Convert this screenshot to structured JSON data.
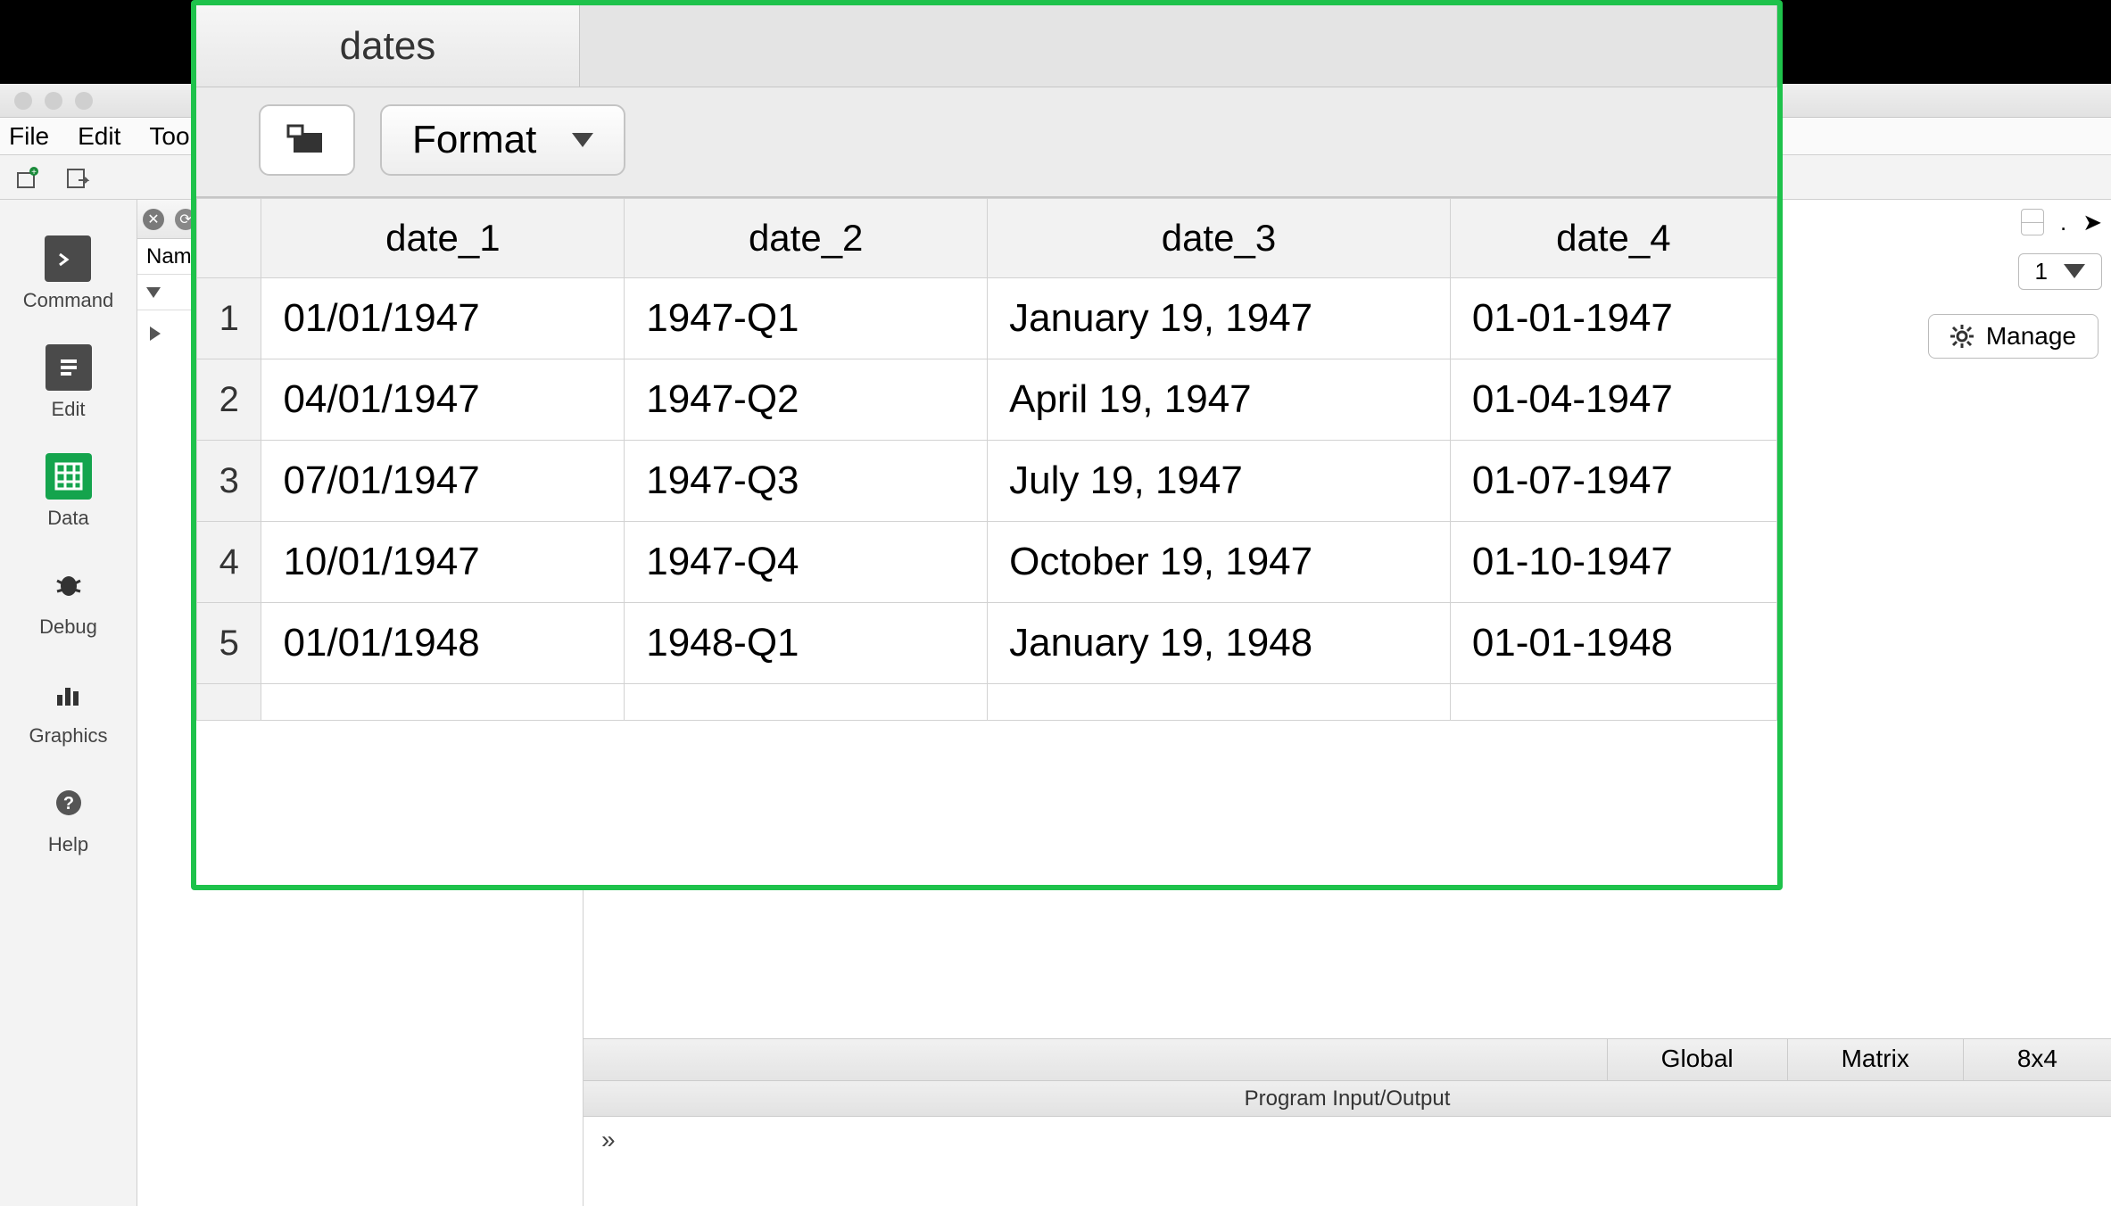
{
  "menubar": {
    "file": "File",
    "edit": "Edit",
    "tool": "Tool"
  },
  "sidebar": {
    "command": "Command",
    "edit": "Edit",
    "data": "Data",
    "debug": "Debug",
    "graphics": "Graphics",
    "help": "Help"
  },
  "names_pane": {
    "header": "Nam"
  },
  "right": {
    "select_value": "1",
    "manage": "Manage"
  },
  "status": {
    "global": "Global",
    "matrix": "Matrix",
    "dims": "8x4"
  },
  "io": {
    "title": "Program Input/Output",
    "prompt": "»"
  },
  "viewer": {
    "tab": "dates",
    "format_label": "Format",
    "columns": [
      "date_1",
      "date_2",
      "date_3",
      "date_4"
    ],
    "rows": [
      {
        "n": "1",
        "c": [
          "01/01/1947",
          "1947-Q1",
          "January 19, 1947",
          "01-01-1947"
        ]
      },
      {
        "n": "2",
        "c": [
          "04/01/1947",
          "1947-Q2",
          "April 19, 1947",
          "01-04-1947"
        ]
      },
      {
        "n": "3",
        "c": [
          "07/01/1947",
          "1947-Q3",
          "July 19, 1947",
          "01-07-1947"
        ]
      },
      {
        "n": "4",
        "c": [
          "10/01/1947",
          "1947-Q4",
          "October 19, 1947",
          "01-10-1947"
        ]
      },
      {
        "n": "5",
        "c": [
          "01/01/1948",
          "1948-Q1",
          "January 19, 1948",
          "01-01-1948"
        ]
      }
    ]
  }
}
